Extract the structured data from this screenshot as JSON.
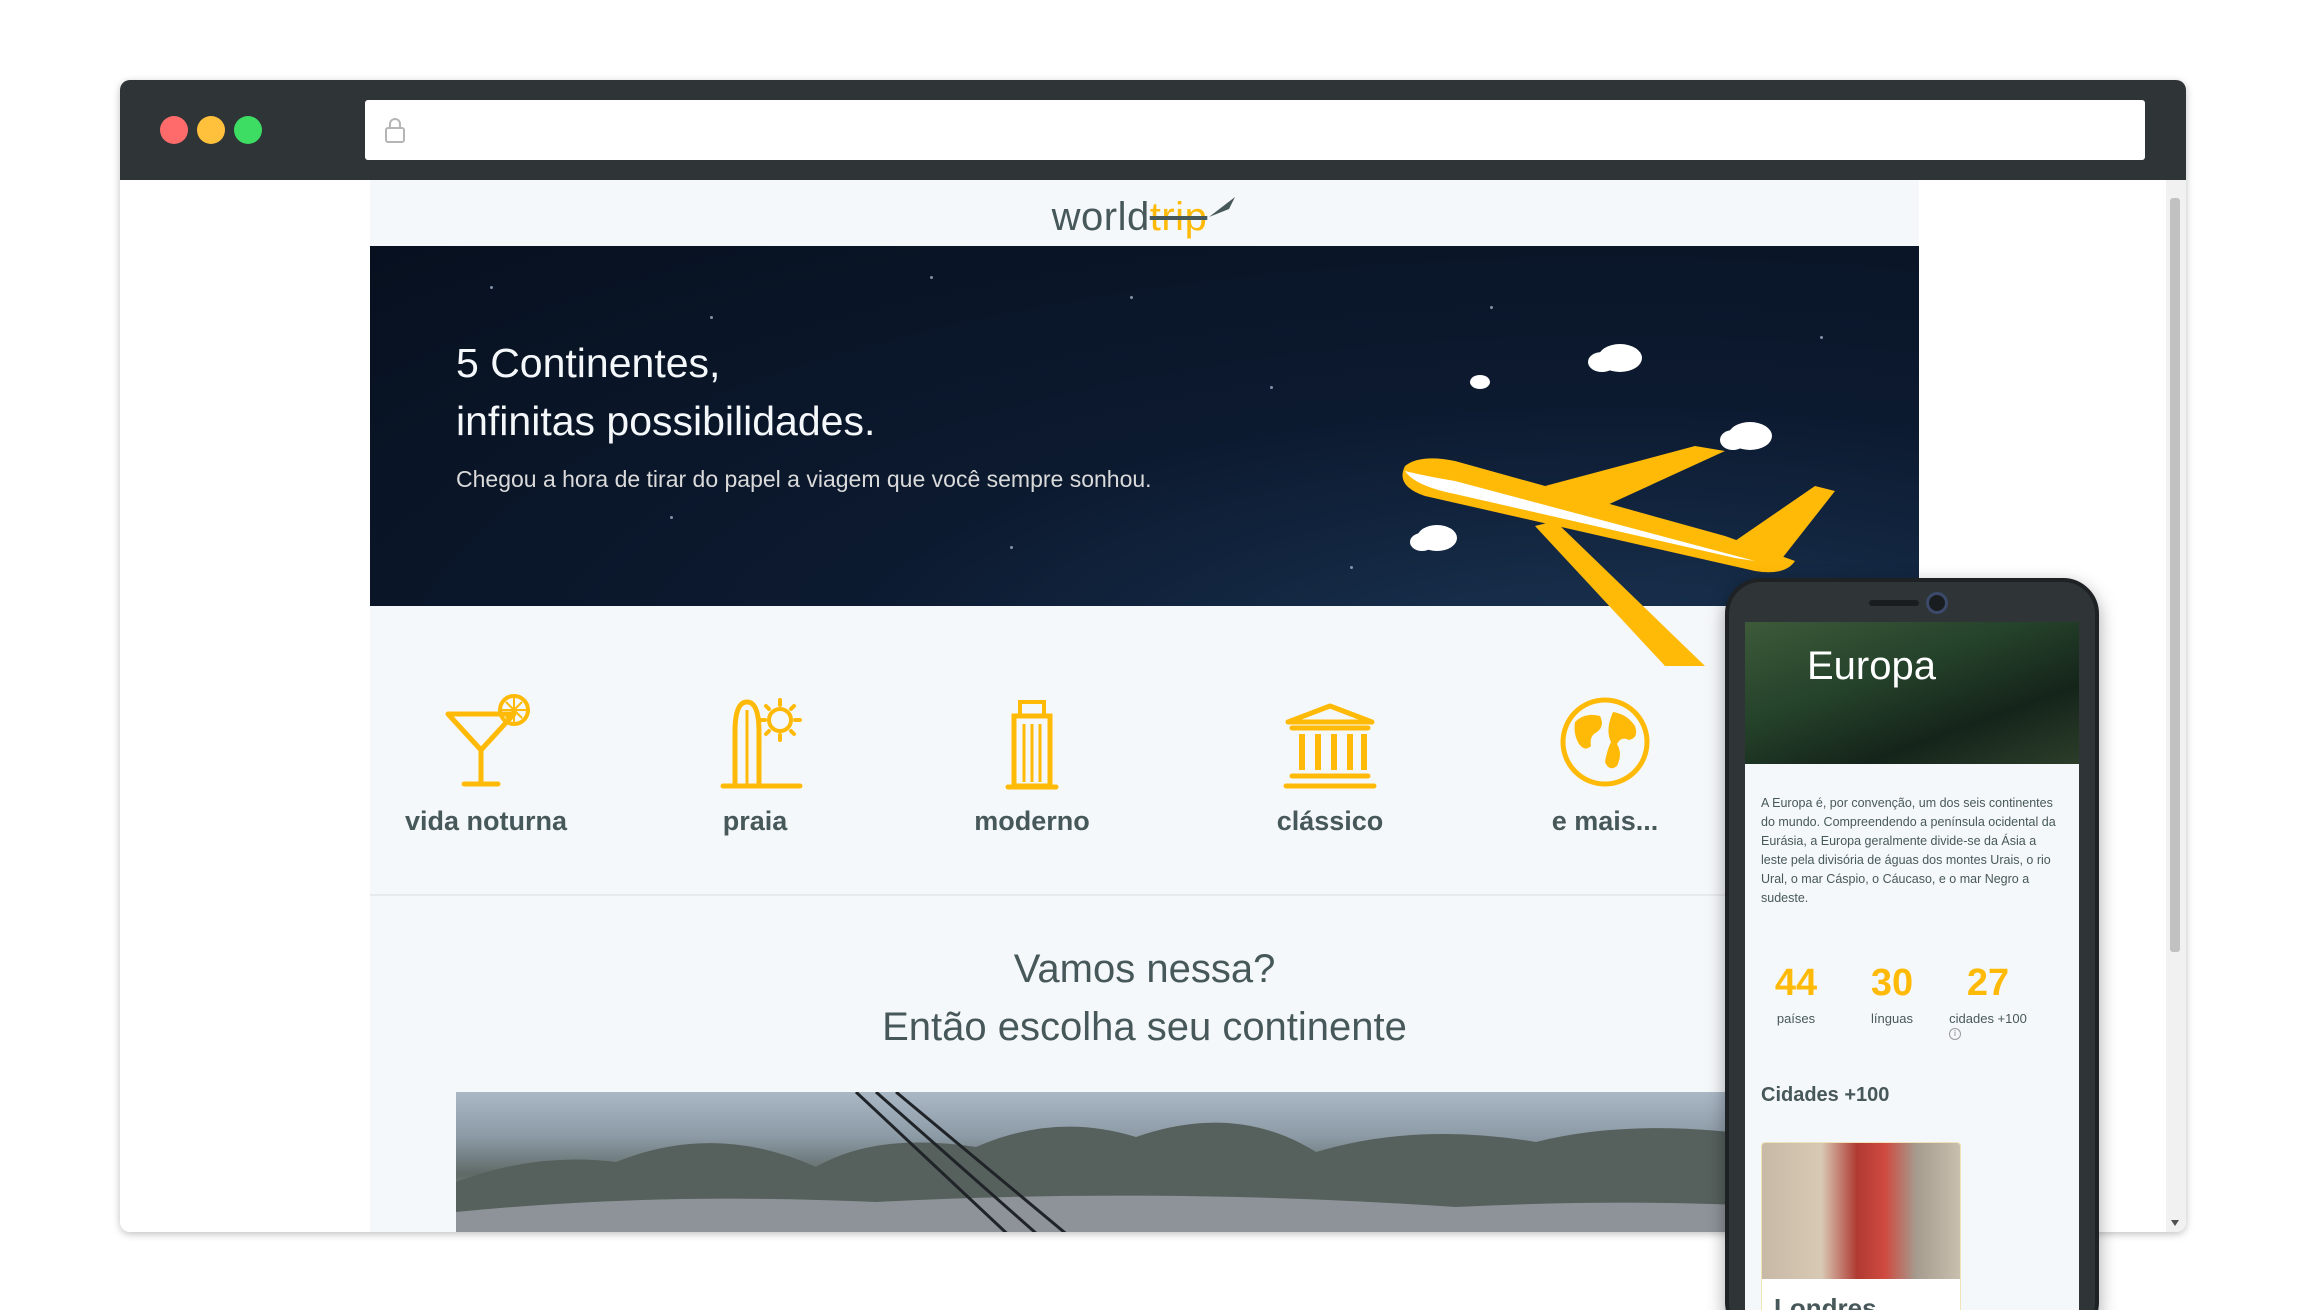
{
  "browser": {
    "address_value": ""
  },
  "site": {
    "logo": {
      "text_main": "world",
      "text_accent": "trip"
    },
    "hero": {
      "title_line1": "5 Continentes,",
      "title_line2": "infinitas possibilidades.",
      "subtitle": "Chegou a hora de tirar do papel a viagem que você sempre sonhou."
    },
    "types": [
      {
        "label": "vida noturna",
        "icon": "cocktail-icon"
      },
      {
        "label": "praia",
        "icon": "surfboard-sun-icon"
      },
      {
        "label": "moderno",
        "icon": "skyscraper-icon"
      },
      {
        "label": "clássico",
        "icon": "museum-icon"
      },
      {
        "label": "e mais...",
        "icon": "globe-icon"
      }
    ],
    "cta": {
      "line1": "Vamos nessa?",
      "line2": "Então escolha seu continente"
    }
  },
  "phone": {
    "banner_title": "Europa",
    "description": "A Europa é, por convenção, um dos seis continentes do mundo. Compreendendo a península ocidental da Eurásia, a Europa geralmente divide-se da Ásia a leste pela divisória de águas dos montes Urais, o rio Ural, o mar Cáspio, o Cáucaso, e o mar Negro a sudeste.",
    "stats": [
      {
        "value": "44",
        "label": "países"
      },
      {
        "value": "30",
        "label": "línguas"
      },
      {
        "value": "27",
        "label": "cidades +100"
      }
    ],
    "info_symbol": "i",
    "cities_heading": "Cidades +100",
    "city_card": {
      "name": "Londres"
    }
  },
  "colors": {
    "accent": "#ffba08",
    "text_dark": "#47585b",
    "background": "#f5f8fa",
    "browser_bar": "#2f3437"
  }
}
